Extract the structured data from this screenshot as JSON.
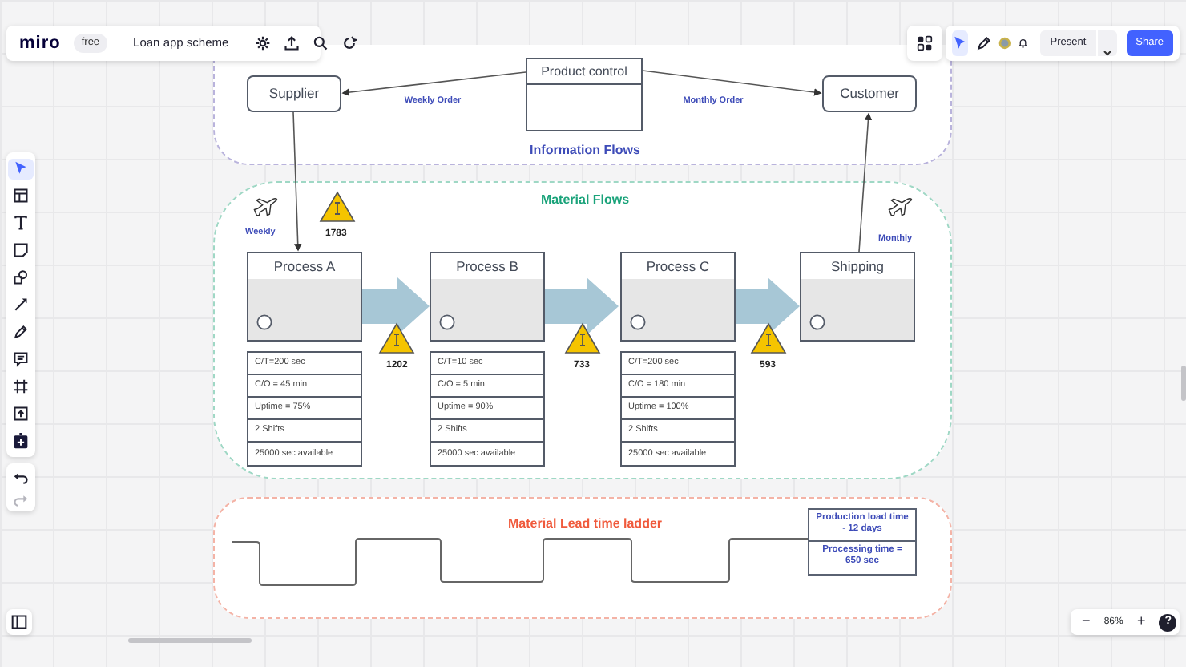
{
  "board": {
    "logo": "miro",
    "plan": "free",
    "title": "Loan app scheme"
  },
  "header_tools": [
    {
      "kind": "settings"
    },
    {
      "kind": "export"
    },
    {
      "kind": "search"
    },
    {
      "kind": "reactions"
    }
  ],
  "apps_tool": {
    "kind": "apps"
  },
  "right_tools": [
    {
      "kind": "select",
      "selected": true
    },
    {
      "kind": "pen",
      "selected": false
    }
  ],
  "present_button": "Present",
  "share_button": "Share",
  "left_tools": [
    {
      "kind": "select",
      "selected": true
    },
    {
      "kind": "template",
      "selected": false
    },
    {
      "kind": "text",
      "selected": false
    },
    {
      "kind": "sticky",
      "selected": false
    },
    {
      "kind": "shapes",
      "selected": false
    },
    {
      "kind": "line",
      "selected": false
    },
    {
      "kind": "pen",
      "selected": false
    },
    {
      "kind": "comment",
      "selected": false
    },
    {
      "kind": "frame",
      "selected": false
    },
    {
      "kind": "upload",
      "selected": false
    },
    {
      "kind": "more",
      "selected": false
    }
  ],
  "history": [
    {
      "kind": "undo",
      "disabled": false
    },
    {
      "kind": "redo",
      "disabled": true
    }
  ],
  "zoom": {
    "out": "−",
    "level": "86%",
    "in": "+",
    "help": "?"
  },
  "information_flows": {
    "title": "Information Flows",
    "product_control": "Product control",
    "supplier": "Supplier",
    "customer": "Customer",
    "labels": [
      "Weekly Order",
      "Monthly Order"
    ]
  },
  "material_flows": {
    "title": "Material Flows",
    "supplier_frequency": "Weekly",
    "customer_frequency": "Monthly",
    "shipping": "Shipping",
    "inventories": [
      "1783",
      "1202",
      "733",
      "593"
    ],
    "processes": [
      {
        "name": "Process A",
        "metrics": [
          "C/T=200 sec",
          "C/O = 45 min",
          "Uptime = 75%",
          "2 Shifts",
          "25000 sec available"
        ]
      },
      {
        "name": "Process B",
        "metrics": [
          "C/T=10 sec",
          "C/O = 5 min",
          "Uptime = 90%",
          "2 Shifts",
          "25000 sec available"
        ]
      },
      {
        "name": "Process C",
        "metrics": [
          "C/T=200 sec",
          "C/O = 180 min",
          "Uptime = 100%",
          "2 Shifts",
          "25000 sec available"
        ]
      }
    ]
  },
  "lead_time": {
    "title": "Material Lead time ladder",
    "summary": [
      "Production load time - 12 days",
      "Processing time = 650 sec"
    ]
  }
}
